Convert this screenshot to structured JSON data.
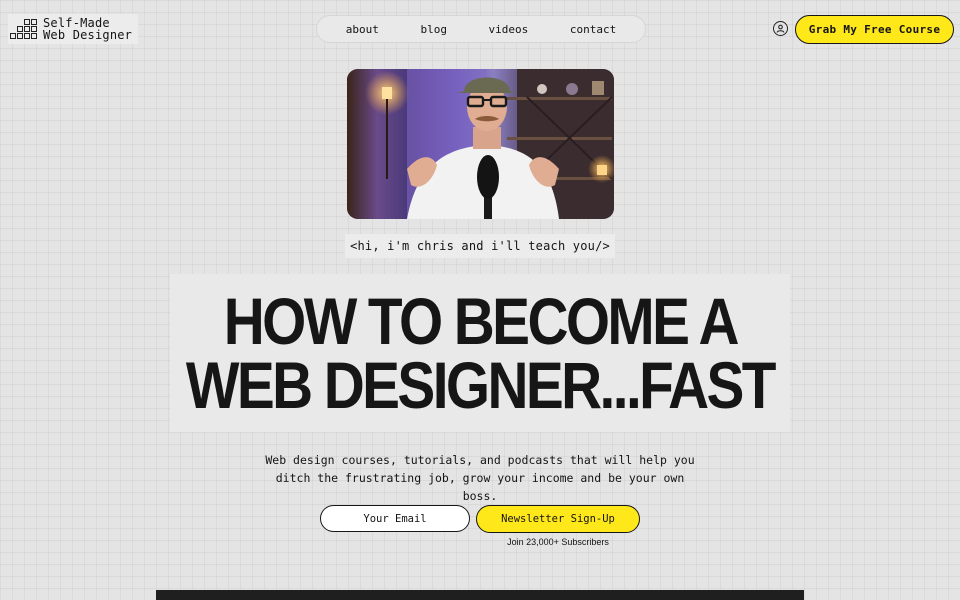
{
  "brand": {
    "line1": "Self-Made",
    "line2": "Web Designer"
  },
  "nav": {
    "items": [
      "about",
      "blog",
      "videos",
      "contact"
    ]
  },
  "header": {
    "cta_label": "Grab My Free Course",
    "user_icon": "user-circle-icon"
  },
  "hero": {
    "tagline": "<hi, i'm chris and i'll teach you/>",
    "headline_line1": "HOW TO BECOME A",
    "headline_line2": "WEB DESIGNER...FAST",
    "subcopy_line1": "Web design courses, tutorials, and podcasts that will help you",
    "subcopy_line2": "ditch the frustrating job, grow your income and be your own boss."
  },
  "signup": {
    "email_placeholder": "Your Email",
    "button_label": "Newsletter Sign-Up",
    "subscribers_note": "Join 23,000+ Subscribers"
  },
  "colors": {
    "accent": "#ffe81a",
    "ink": "#141414",
    "background": "#e4e4e4"
  }
}
